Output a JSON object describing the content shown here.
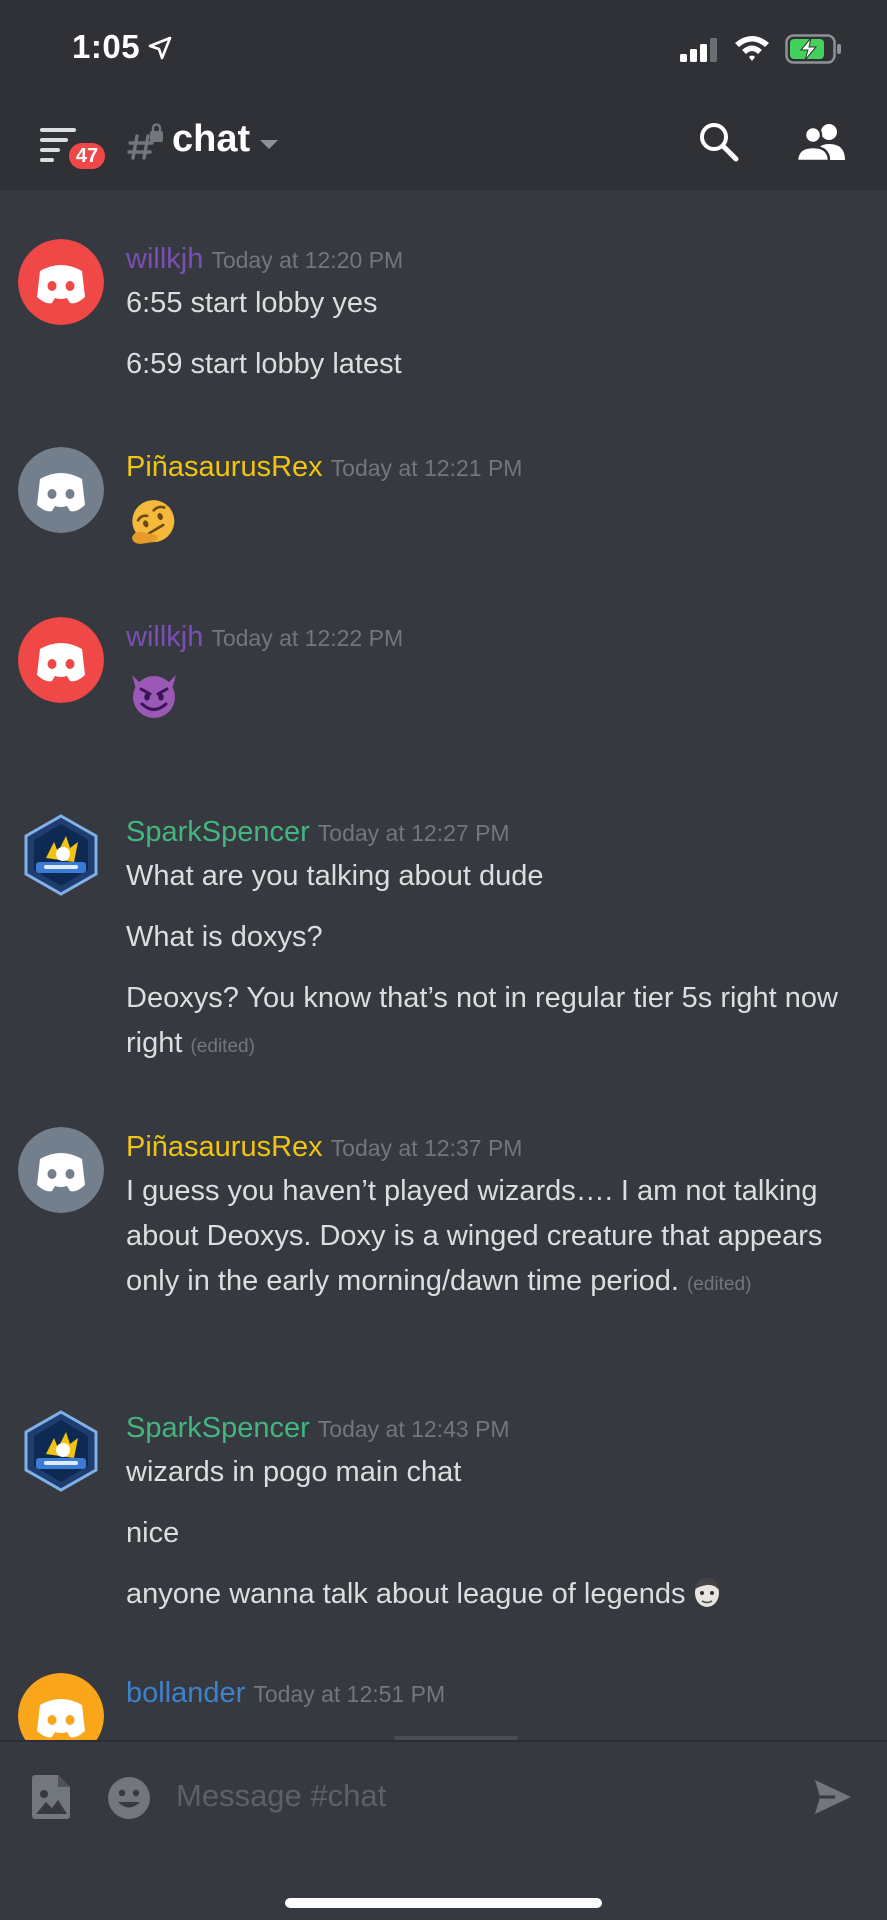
{
  "status_bar": {
    "time": "1:05"
  },
  "header": {
    "channel_name": "chat",
    "unread_count": "47"
  },
  "colors": {
    "willkjh": "#7a4fb3",
    "PiñasaurusRex": "#f1c40f",
    "SparkSpencer": "#43b581",
    "bollander": "#3e82cc",
    "avatar_red": "#f04747",
    "avatar_grey": "#747f8d",
    "avatar_orange": "#faa61a"
  },
  "messages": [
    {
      "username": "willkjh",
      "timestamp": "Today at 12:20 PM",
      "avatar": "discord-red",
      "lines": [
        "6:55 start lobby yes",
        "6:59 start lobby latest"
      ]
    },
    {
      "username": "PiñasaurusRex",
      "timestamp": "Today at 12:21 PM",
      "avatar": "discord-grey",
      "emoji": "thinking-face-emoji"
    },
    {
      "username": "willkjh",
      "timestamp": "Today at 12:22 PM",
      "avatar": "discord-red",
      "emoji": "smiling-imp-emoji"
    },
    {
      "username": "SparkSpencer",
      "timestamp": "Today at 12:27 PM",
      "avatar": "sparkspencer-badge",
      "lines": [
        "What are you talking about dude",
        "What is doxys?",
        "Deoxys? You know that’s not in regular tier 5s right now right"
      ],
      "edited_label": "(edited)"
    },
    {
      "username": "PiñasaurusRex",
      "timestamp": "Today at 12:37 PM",
      "avatar": "discord-grey",
      "lines": [
        "I guess you haven’t played wizards…. I am not talking about Deoxys. Doxy is a winged creature that appears only in the early morning/dawn time period."
      ],
      "edited_label": "(edited)"
    },
    {
      "username": "SparkSpencer",
      "timestamp": "Today at 12:43 PM",
      "avatar": "sparkspencer-badge",
      "lines": [
        "wizards in pogo main chat",
        "nice",
        "anyone wanna talk about league of legends"
      ],
      "inline_emoji": "custom-face-emoji"
    },
    {
      "username": "bollander",
      "timestamp": "Today at 12:51 PM",
      "avatar": "discord-orange"
    }
  ],
  "composer": {
    "placeholder": "Message #chat"
  },
  "icons": [
    "location-arrow-icon",
    "cellular-signal-icon",
    "wifi-icon",
    "battery-charging-icon",
    "hamburger-menu-icon",
    "text-channel-lock-icon",
    "dropdown-caret-icon",
    "search-icon",
    "members-icon",
    "image-attach-icon",
    "emoji-picker-icon",
    "send-icon"
  ]
}
